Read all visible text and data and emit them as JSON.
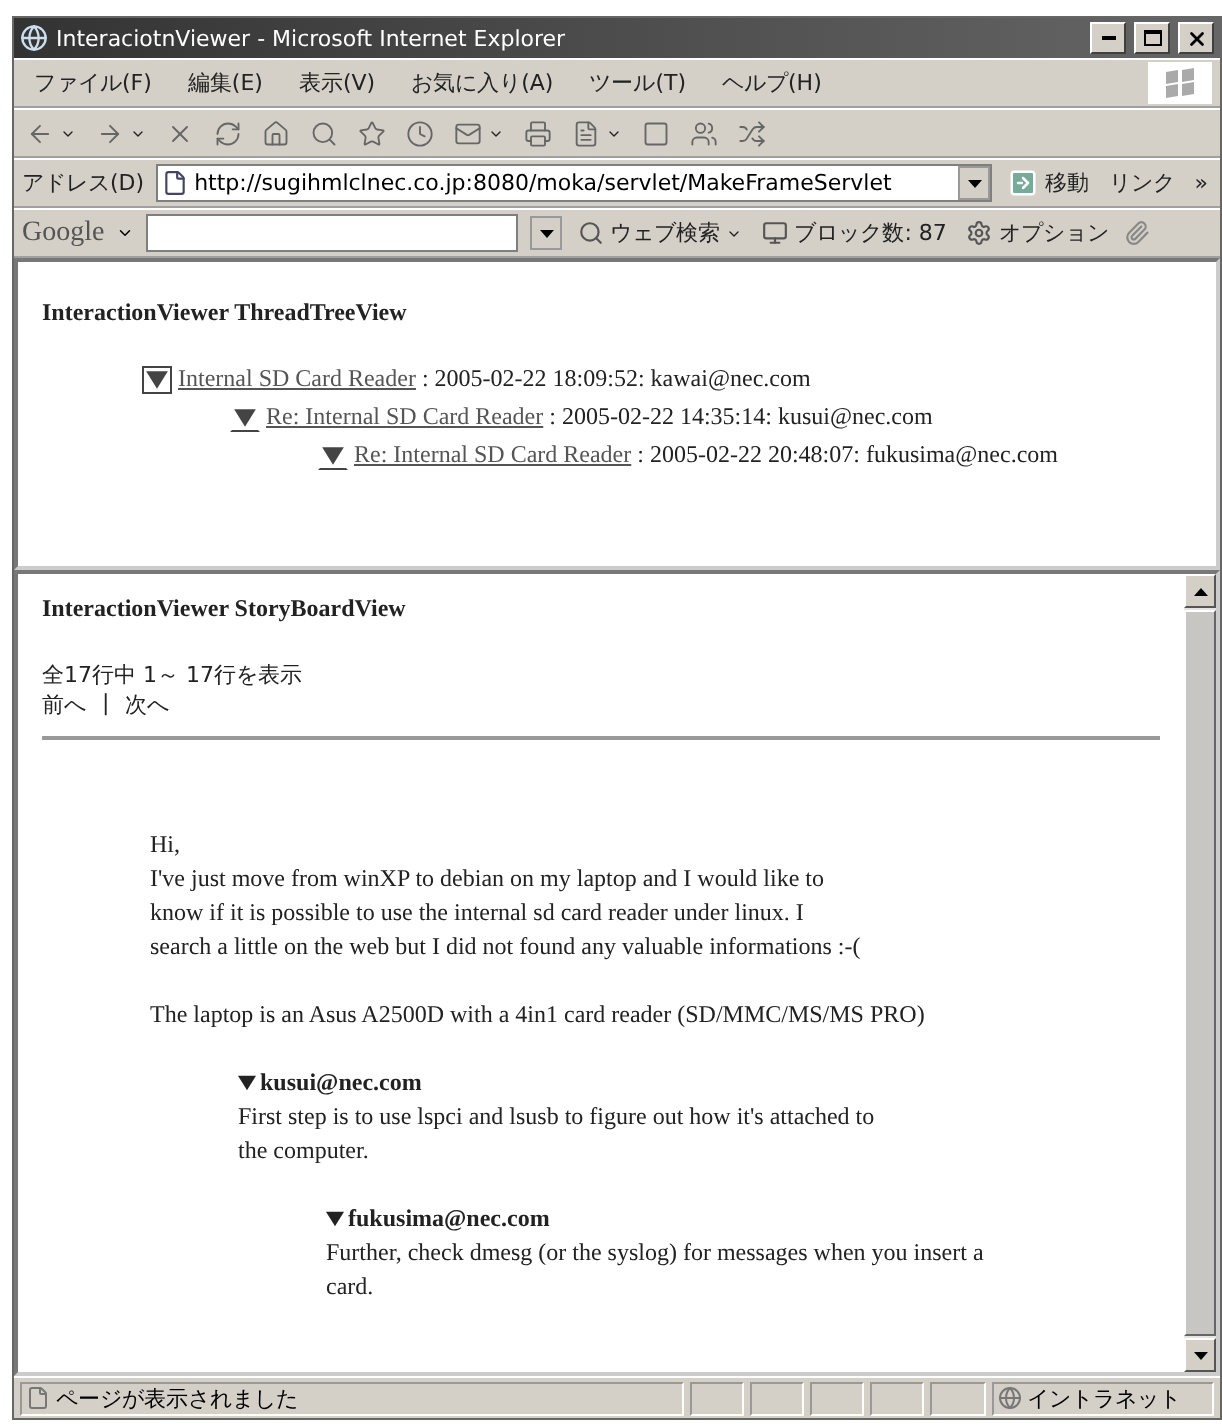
{
  "window": {
    "title": "InteraciotnViewer - Microsoft Internet Explorer"
  },
  "menu": [
    "ファイル(F)",
    "編集(E)",
    "表示(V)",
    "お気に入り(A)",
    "ツール(T)",
    "ヘルプ(H)"
  ],
  "address_bar": {
    "label": "アドレス(D)",
    "value": "http://sugihmlclnec.co.jp:8080/moka/servlet/MakeFrameServlet",
    "go": "移動",
    "links": "リンク",
    "more": "»"
  },
  "google_bar": {
    "logo": "Google",
    "search": "ウェブ検索",
    "blocked": "ブロック数: 87",
    "options": "オプション"
  },
  "thread_tree": {
    "title": "InteractionViewer ThreadTreeView",
    "items": [
      {
        "subject": "Internal SD Card Reader",
        "meta": ":  2005-02-22 18:09:52:  kawai@nec.com",
        "expanded": true,
        "selected": true,
        "children": [
          {
            "subject": "Re: Internal SD Card Reader",
            "meta": ":  2005-02-22 14:35:14:  kusui@nec.com",
            "expanded": true,
            "selected": false,
            "children": [
              {
                "subject": "Re: Internal SD Card Reader",
                "meta": ":  2005-02-22 20:48:07:  fukusima@nec.com",
                "expanded": true,
                "selected": false
              }
            ]
          }
        ]
      }
    ]
  },
  "story_board": {
    "title": "InteractionViewer StoryBoardView",
    "count": "全17行中 1～ 17行を表示",
    "prev": "前へ",
    "separator": "|",
    "next": "次へ",
    "message": [
      "Hi,\nI've just move from winXP to debian on my laptop and I would like to\nknow if it is possible to use the internal sd card reader under linux. I\nsearch a little on the web but I did not found any valuable informations :-(",
      "The laptop is an Asus A2500D with a 4in1  card reader (SD/MMC/MS/MS PRO)"
    ],
    "replies": [
      {
        "author": "kusui@nec.com",
        "expanded": true,
        "body": "First step is to use lspci and lsusb to figure out how it's attached to\nthe computer.",
        "replies": [
          {
            "author": "fukusima@nec.com",
            "expanded": true,
            "body": "Further, check dmesg (or the syslog) for messages when you insert a\ncard."
          }
        ]
      }
    ]
  },
  "status_bar": {
    "text": "ページが表示されました",
    "zone": "イントラネット"
  }
}
